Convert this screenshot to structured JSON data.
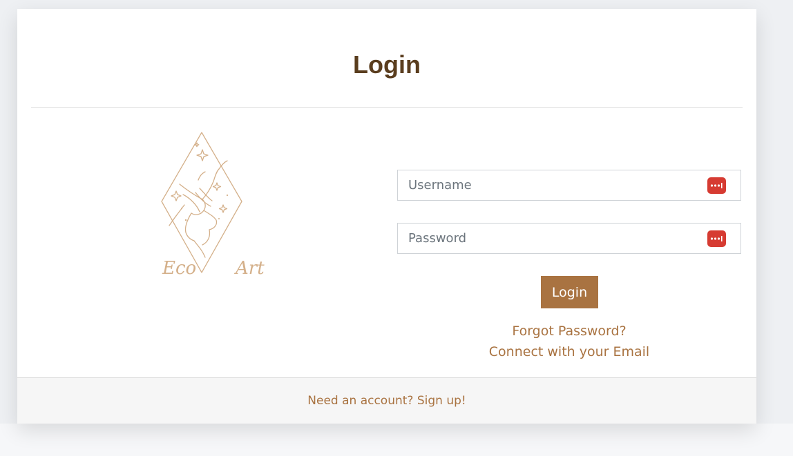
{
  "header": {
    "title": "Login"
  },
  "logo": {
    "left_word": "Eco",
    "right_word": "Art",
    "color": "#d4b08a"
  },
  "form": {
    "username": {
      "placeholder": "Username",
      "value": ""
    },
    "password": {
      "placeholder": "Password",
      "value": ""
    },
    "password_manager_icon": "password-manager-icon",
    "submit_label": "Login"
  },
  "links": {
    "forgot_password": "Forgot Password?",
    "connect_email": "Connect with your Email"
  },
  "footer": {
    "signup": "Need an account? Sign up!"
  },
  "colors": {
    "accent": "#a97341",
    "title": "#5a3d1e",
    "icon_red": "#d63b32"
  }
}
